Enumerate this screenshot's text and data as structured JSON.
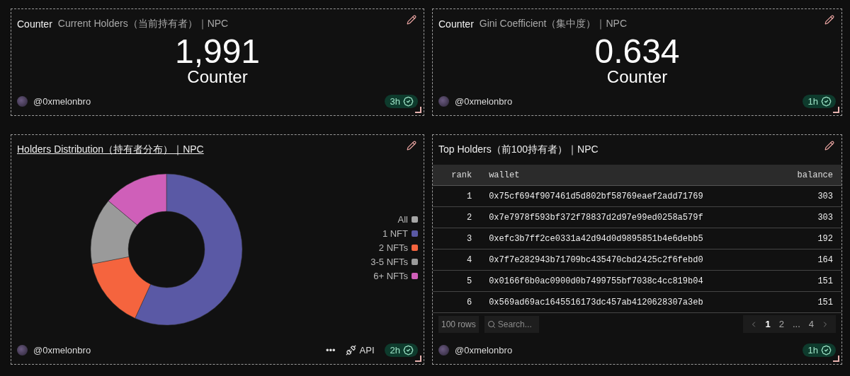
{
  "cards": [
    {
      "kind": "counter",
      "type_label": "Counter",
      "title": "Current Holders（当前持有者）｜NPC",
      "value": "1,991",
      "caption": "Counter",
      "author": "@0xmelonbro",
      "age": "3h"
    },
    {
      "kind": "counter",
      "type_label": "Counter",
      "title": "Gini Coefficient（集中度）｜NPC",
      "value": "0.634",
      "caption": "Counter",
      "author": "@0xmelonbro",
      "age": "1h"
    },
    {
      "kind": "chart",
      "title": "Holders Distribution（持有者分布）｜NPC",
      "legend": [
        {
          "label": "All",
          "color": "#a6a6a6"
        },
        {
          "label": "1 NFT",
          "color": "#5a59a5"
        },
        {
          "label": "2 NFTs",
          "color": "#f5643e"
        },
        {
          "label": "3-5 NFTs",
          "color": "#9a9a9a"
        },
        {
          "label": "6+ NFTs",
          "color": "#cf5fb9"
        }
      ],
      "more": "•••",
      "api": "API",
      "author": "@0xmelonbro",
      "age": "2h"
    },
    {
      "kind": "table",
      "title": "Top Holders（前100持有者）｜NPC",
      "columns": [
        "rank",
        "wallet",
        "balance"
      ],
      "rows": [
        [
          "1",
          "0x75cf694f907461d5d802bf58769eaef2add71769",
          "303"
        ],
        [
          "2",
          "0x7e7978f593bf372f78837d2d97e99ed0258a579f",
          "303"
        ],
        [
          "3",
          "0xefc3b7ff2ce0331a42d94d0d9895851b4e6debb5",
          "192"
        ],
        [
          "4",
          "0x7f7e282943b71709bc435470cbd2425c2f6febd0",
          "164"
        ],
        [
          "5",
          "0x0166f6b0ac0900d0b7499755bf7038c4cc819b04",
          "151"
        ],
        [
          "6",
          "0x569ad69ac1645516173dc457ab4120628307a3eb",
          "151"
        ]
      ],
      "rows_label": "100 rows",
      "search": {
        "placeholder": "Search..."
      },
      "pages": [
        {
          "label": "1",
          "selected": true
        },
        {
          "label": "2",
          "selected": false
        },
        {
          "label": "...",
          "selected": false
        },
        {
          "label": "4",
          "selected": false
        }
      ],
      "author": "@0xmelonbro",
      "age": "1h"
    }
  ]
}
